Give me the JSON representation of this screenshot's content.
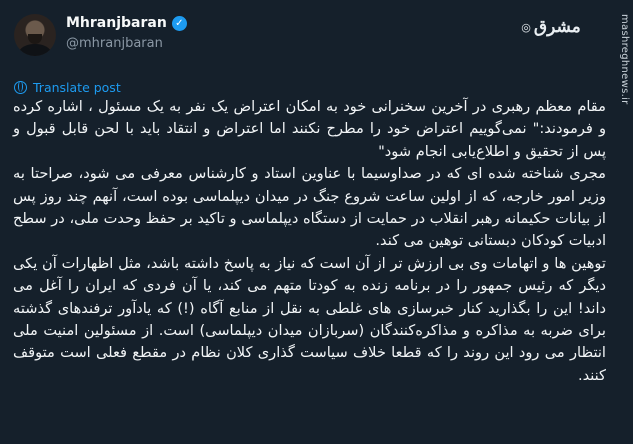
{
  "author": {
    "display_name": "Mhranjbaran",
    "handle": "@mhranjbaran",
    "verified_icon": "verified-badge",
    "verified_color": "#1d9bf0"
  },
  "site_logo": {
    "text": "مشرق",
    "icon": "mashregh-logo"
  },
  "watermark": "mashreghnews.ir",
  "translate": {
    "label": "Translate post",
    "icon": "globe-icon"
  },
  "tweet": {
    "paragraphs": [
      "مقام معظم رهبری در آخرین سخنرانی خود به امکان اعتراض یک نفر به یک مسئول ، اشاره کرده و فرمودند:\" نمی‌گوییم اعتراض خود را مطرح نکنند اما اعتراض و انتقاد باید با لحن قابل قبول و پس از تحقیق و اطلاع‌یابی انجام شود\"",
      "مجری شناخته شده ای که در صداوسیما با عناوین استاد و کارشناس معرفی می شود، صراحتا به وزیر امور خارجه، که از اولین ساعت شروع جنگ در میدان دیپلماسی بوده است، آنهم چند روز پس از بیانات حکیمانه رهبر انقلاب در حمایت از دستگاه دیپلماسی و تاکید بر حفظ وحدت ملی، در سطح ادبیات کودکان دبستانی توهین می کند.",
      "توهین ها و اتهامات وی بی ارزش تر از آن است که نیاز به پاسخ داشته باشد، مثل اظهارات آن یکی دیگر که رئیس جمهور را در برنامه زنده به کودتا متهم می کند، یا آن فردی که ایران را آغل می داند! این را بگذارید کنار خبرسازی های غلطی به نقل از منابع آگاه (!) که یادآور ترفندهای گذشته برای ضربه به مذاکره و مذاکره‌کنندگان (سربازان میدان دیپلماسی) است. از مسئولین امنیت ملی انتظار می رود این روند را که قطعا خلاف سیاست گذاری کلان نظام در مقطع فعلی است متوقف کنند."
    ]
  },
  "colors": {
    "background": "#15202b",
    "text": "#f7f9f9",
    "muted": "#8b98a5",
    "accent": "#1d9bf0"
  }
}
